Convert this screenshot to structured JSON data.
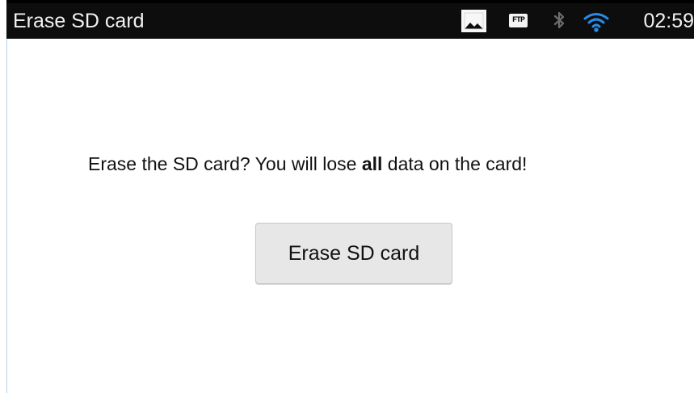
{
  "window": {
    "title": "Erase SD card"
  },
  "status_bar": {
    "icons": [
      "image-icon",
      "ftp-icon",
      "bluetooth-icon",
      "wifi-icon"
    ],
    "ftp_label": "FTP",
    "time": "02:59",
    "accent_color": "#2a8be5"
  },
  "content": {
    "message_before": "Erase the SD card? You will lose ",
    "message_emphasis": "all",
    "message_after": " data on the card!",
    "button_label": "Erase SD card"
  }
}
